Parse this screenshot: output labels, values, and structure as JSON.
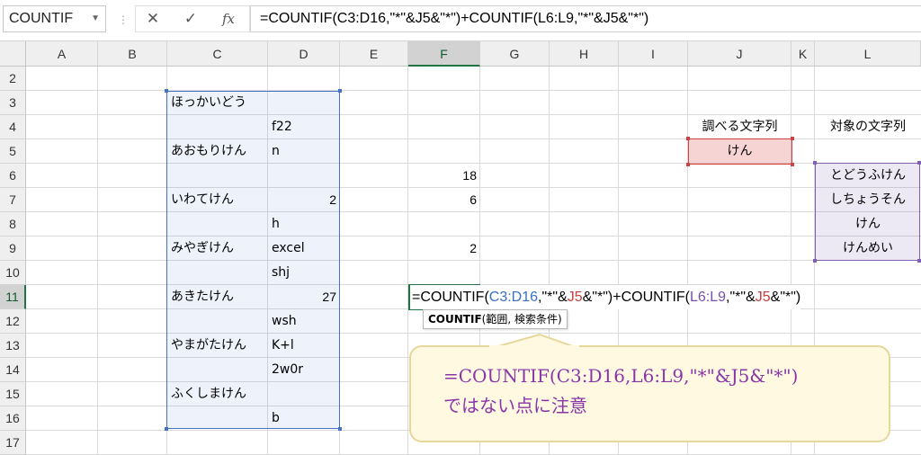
{
  "formula_bar": {
    "name_box": "COUNTIF",
    "cancel_icon": "✕",
    "enter_icon": "✓",
    "fx_label": "fx",
    "formula": "=COUNTIF(C3:D16,\"*\"&J5&\"*\")+COUNTIF(L6:L9,\"*\"&J5&\"*\")"
  },
  "columns": [
    "A",
    "B",
    "C",
    "D",
    "E",
    "F",
    "G",
    "H",
    "I",
    "J",
    "K",
    "L"
  ],
  "rows": [
    "2",
    "3",
    "4",
    "5",
    "6",
    "7",
    "8",
    "9",
    "10",
    "11",
    "12",
    "13",
    "14",
    "15",
    "16",
    "17"
  ],
  "cells": {
    "C3": "ほっかいどう",
    "D4": "f22",
    "C5": "あおもりけん",
    "D5": "n",
    "C7": "いわてけん",
    "D7": "2",
    "D8": "h",
    "C9": "みやぎけん",
    "D9": "excel",
    "D10": "shj",
    "C11": "あきたけん",
    "D11": "27",
    "D12": "wsh",
    "C13": "やまがたけん",
    "D13": "K+l",
    "D14": "2w0r",
    "C15": "ふくしまけん",
    "D16": "b",
    "F6": "18",
    "F7": "6",
    "F9": "2",
    "J4": "調べる文字列",
    "J5": "けん",
    "L4": "対象の文字列",
    "L6": "とどうふけん",
    "L7": "しちょうそん",
    "L8": "けん",
    "L9": "けんめい"
  },
  "editing": {
    "parts": [
      {
        "t": "=COUNTIF(",
        "c": "#000000"
      },
      {
        "t": "C3:D16",
        "c": "#3b6fc2"
      },
      {
        "t": ",\"*\"&",
        "c": "#000000"
      },
      {
        "t": "J5",
        "c": "#c83c3c"
      },
      {
        "t": "&\"*\")+COUNTIF(",
        "c": "#000000"
      },
      {
        "t": "L6:L9",
        "c": "#7a4fb0"
      },
      {
        "t": ",\"*\"&",
        "c": "#000000"
      },
      {
        "t": "J5",
        "c": "#c83c3c"
      },
      {
        "t": "&\"*\")",
        "c": "#000000"
      }
    ],
    "tooltip_fn": "COUNTIF",
    "tooltip_args": "(範囲, 検索条件)"
  },
  "callout": {
    "line1": "=COUNTIF(C3:D16,L6:L9,\"*\"&J5&\"*\")",
    "line2": "ではない点に注意"
  },
  "colors": {
    "accent_green": "#217346",
    "range_blue": "#4472c4",
    "range_red": "#d04040",
    "range_purple": "#8060b0",
    "callout_text": "#8a35a8"
  }
}
